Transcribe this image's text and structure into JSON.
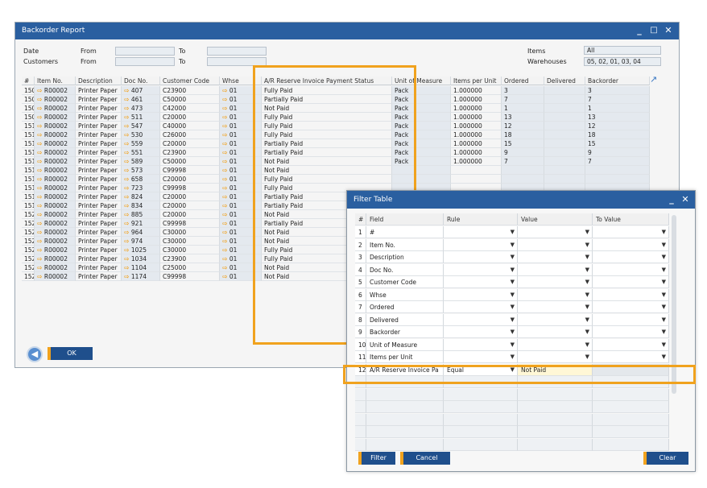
{
  "main": {
    "title": "Backorder Report",
    "date_label": "Date",
    "customers_label": "Customers",
    "from_label": "From",
    "to_label": "To",
    "items_label": "Items",
    "items_value": "All",
    "warehouses_label": "Warehouses",
    "warehouses_value": "05, 02, 01, 03, 04",
    "ok_label": "OK",
    "columns": [
      "#",
      "Item No.",
      "Description",
      "Doc No.",
      "Customer Code",
      "Whse",
      "A/R Reserve Invoice Payment Status",
      "Unit of Measure",
      "Items per Unit",
      "Ordered",
      "Delivered",
      "Backorder"
    ],
    "rows": [
      {
        "n": "150",
        "item": "R00002",
        "desc": "Printer Paper",
        "doc": "407",
        "cust": "C23900",
        "whse": "01",
        "status": "Fully Paid",
        "uom": "Pack",
        "ipu": "1.000000",
        "ord": "3",
        "bo": "3"
      },
      {
        "n": "150",
        "item": "R00002",
        "desc": "Printer Paper",
        "doc": "461",
        "cust": "C50000",
        "whse": "01",
        "status": "Partially Paid",
        "uom": "Pack",
        "ipu": "1.000000",
        "ord": "7",
        "bo": "7"
      },
      {
        "n": "150",
        "item": "R00002",
        "desc": "Printer Paper",
        "doc": "473",
        "cust": "C42000",
        "whse": "01",
        "status": "Not Paid",
        "uom": "Pack",
        "ipu": "1.000000",
        "ord": "1",
        "bo": "1"
      },
      {
        "n": "150",
        "item": "R00002",
        "desc": "Printer Paper",
        "doc": "511",
        "cust": "C20000",
        "whse": "01",
        "status": "Fully Paid",
        "uom": "Pack",
        "ipu": "1.000000",
        "ord": "13",
        "bo": "13"
      },
      {
        "n": "151",
        "item": "R00002",
        "desc": "Printer Paper",
        "doc": "547",
        "cust": "C40000",
        "whse": "01",
        "status": "Fully Paid",
        "uom": "Pack",
        "ipu": "1.000000",
        "ord": "12",
        "bo": "12"
      },
      {
        "n": "151",
        "item": "R00002",
        "desc": "Printer Paper",
        "doc": "530",
        "cust": "C26000",
        "whse": "01",
        "status": "Fully Paid",
        "uom": "Pack",
        "ipu": "1.000000",
        "ord": "18",
        "bo": "18"
      },
      {
        "n": "151",
        "item": "R00002",
        "desc": "Printer Paper",
        "doc": "559",
        "cust": "C20000",
        "whse": "01",
        "status": "Partially Paid",
        "uom": "Pack",
        "ipu": "1.000000",
        "ord": "15",
        "bo": "15"
      },
      {
        "n": "151",
        "item": "R00002",
        "desc": "Printer Paper",
        "doc": "551",
        "cust": "C23900",
        "whse": "01",
        "status": "Partially Paid",
        "uom": "Pack",
        "ipu": "1.000000",
        "ord": "9",
        "bo": "9"
      },
      {
        "n": "151",
        "item": "R00002",
        "desc": "Printer Paper",
        "doc": "589",
        "cust": "C50000",
        "whse": "01",
        "status": "Not Paid",
        "uom": "Pack",
        "ipu": "1.000000",
        "ord": "7",
        "bo": "7"
      },
      {
        "n": "151",
        "item": "R00002",
        "desc": "Printer Paper",
        "doc": "573",
        "cust": "C99998",
        "whse": "01",
        "status": "Not Paid",
        "uom": "",
        "ipu": "",
        "ord": "",
        "bo": ""
      },
      {
        "n": "151",
        "item": "R00002",
        "desc": "Printer Paper",
        "doc": "658",
        "cust": "C20000",
        "whse": "01",
        "status": "Fully Paid",
        "uom": "",
        "ipu": "",
        "ord": "",
        "bo": ""
      },
      {
        "n": "151",
        "item": "R00002",
        "desc": "Printer Paper",
        "doc": "723",
        "cust": "C99998",
        "whse": "01",
        "status": "Fully Paid",
        "uom": "",
        "ipu": "",
        "ord": "",
        "bo": ""
      },
      {
        "n": "151",
        "item": "R00002",
        "desc": "Printer Paper",
        "doc": "824",
        "cust": "C20000",
        "whse": "01",
        "status": "Partially Paid",
        "uom": "",
        "ipu": "",
        "ord": "",
        "bo": ""
      },
      {
        "n": "151",
        "item": "R00002",
        "desc": "Printer Paper",
        "doc": "834",
        "cust": "C20000",
        "whse": "01",
        "status": "Partially Paid",
        "uom": "",
        "ipu": "",
        "ord": "",
        "bo": ""
      },
      {
        "n": "152",
        "item": "R00002",
        "desc": "Printer Paper",
        "doc": "885",
        "cust": "C20000",
        "whse": "01",
        "status": "Not Paid",
        "uom": "",
        "ipu": "",
        "ord": "",
        "bo": ""
      },
      {
        "n": "152",
        "item": "R00002",
        "desc": "Printer Paper",
        "doc": "921",
        "cust": "C99998",
        "whse": "01",
        "status": "Partially Paid",
        "uom": "",
        "ipu": "",
        "ord": "",
        "bo": ""
      },
      {
        "n": "152",
        "item": "R00002",
        "desc": "Printer Paper",
        "doc": "964",
        "cust": "C30000",
        "whse": "01",
        "status": "Not Paid",
        "uom": "",
        "ipu": "",
        "ord": "",
        "bo": ""
      },
      {
        "n": "152",
        "item": "R00002",
        "desc": "Printer Paper",
        "doc": "974",
        "cust": "C30000",
        "whse": "01",
        "status": "Not Paid",
        "uom": "",
        "ipu": "",
        "ord": "",
        "bo": ""
      },
      {
        "n": "152",
        "item": "R00002",
        "desc": "Printer Paper",
        "doc": "1025",
        "cust": "C30000",
        "whse": "01",
        "status": "Fully Paid",
        "uom": "",
        "ipu": "",
        "ord": "",
        "bo": ""
      },
      {
        "n": "152",
        "item": "R00002",
        "desc": "Printer Paper",
        "doc": "1034",
        "cust": "C23900",
        "whse": "01",
        "status": "Fully Paid",
        "uom": "",
        "ipu": "",
        "ord": "",
        "bo": ""
      },
      {
        "n": "152",
        "item": "R00002",
        "desc": "Printer Paper",
        "doc": "1104",
        "cust": "C25000",
        "whse": "01",
        "status": "Not Paid",
        "uom": "",
        "ipu": "",
        "ord": "",
        "bo": ""
      },
      {
        "n": "152",
        "item": "R00002",
        "desc": "Printer Paper",
        "doc": "1174",
        "cust": "C99998",
        "whse": "01",
        "status": "Not Paid",
        "uom": "",
        "ipu": "",
        "ord": "",
        "bo": ""
      }
    ]
  },
  "filter": {
    "title": "Filter Table",
    "columns": [
      "#",
      "Field",
      "Rule",
      "Value",
      "To Value"
    ],
    "rows": [
      {
        "n": "1",
        "field": "#",
        "rule": "",
        "value": ""
      },
      {
        "n": "2",
        "field": "Item No.",
        "rule": "",
        "value": ""
      },
      {
        "n": "3",
        "field": "Description",
        "rule": "",
        "value": ""
      },
      {
        "n": "4",
        "field": "Doc No.",
        "rule": "",
        "value": ""
      },
      {
        "n": "5",
        "field": "Customer Code",
        "rule": "",
        "value": ""
      },
      {
        "n": "6",
        "field": "Whse",
        "rule": "",
        "value": ""
      },
      {
        "n": "7",
        "field": "Ordered",
        "rule": "",
        "value": ""
      },
      {
        "n": "8",
        "field": "Delivered",
        "rule": "",
        "value": ""
      },
      {
        "n": "9",
        "field": "Backorder",
        "rule": "",
        "value": ""
      },
      {
        "n": "10",
        "field": "Unit of Measure",
        "rule": "",
        "value": ""
      },
      {
        "n": "11",
        "field": "Items per Unit",
        "rule": "",
        "value": ""
      },
      {
        "n": "12",
        "field": "A/R Reserve Invoice Pa",
        "rule": "Equal",
        "value": "Not Paid"
      }
    ],
    "filter_label": "Filter",
    "cancel_label": "Cancel",
    "clear_label": "Clear",
    "dropdown_glyph": "▼"
  },
  "colors": {
    "accent": "#f0a21e",
    "titlebar": "#2a5fa0",
    "button": "#1f4f8c"
  }
}
